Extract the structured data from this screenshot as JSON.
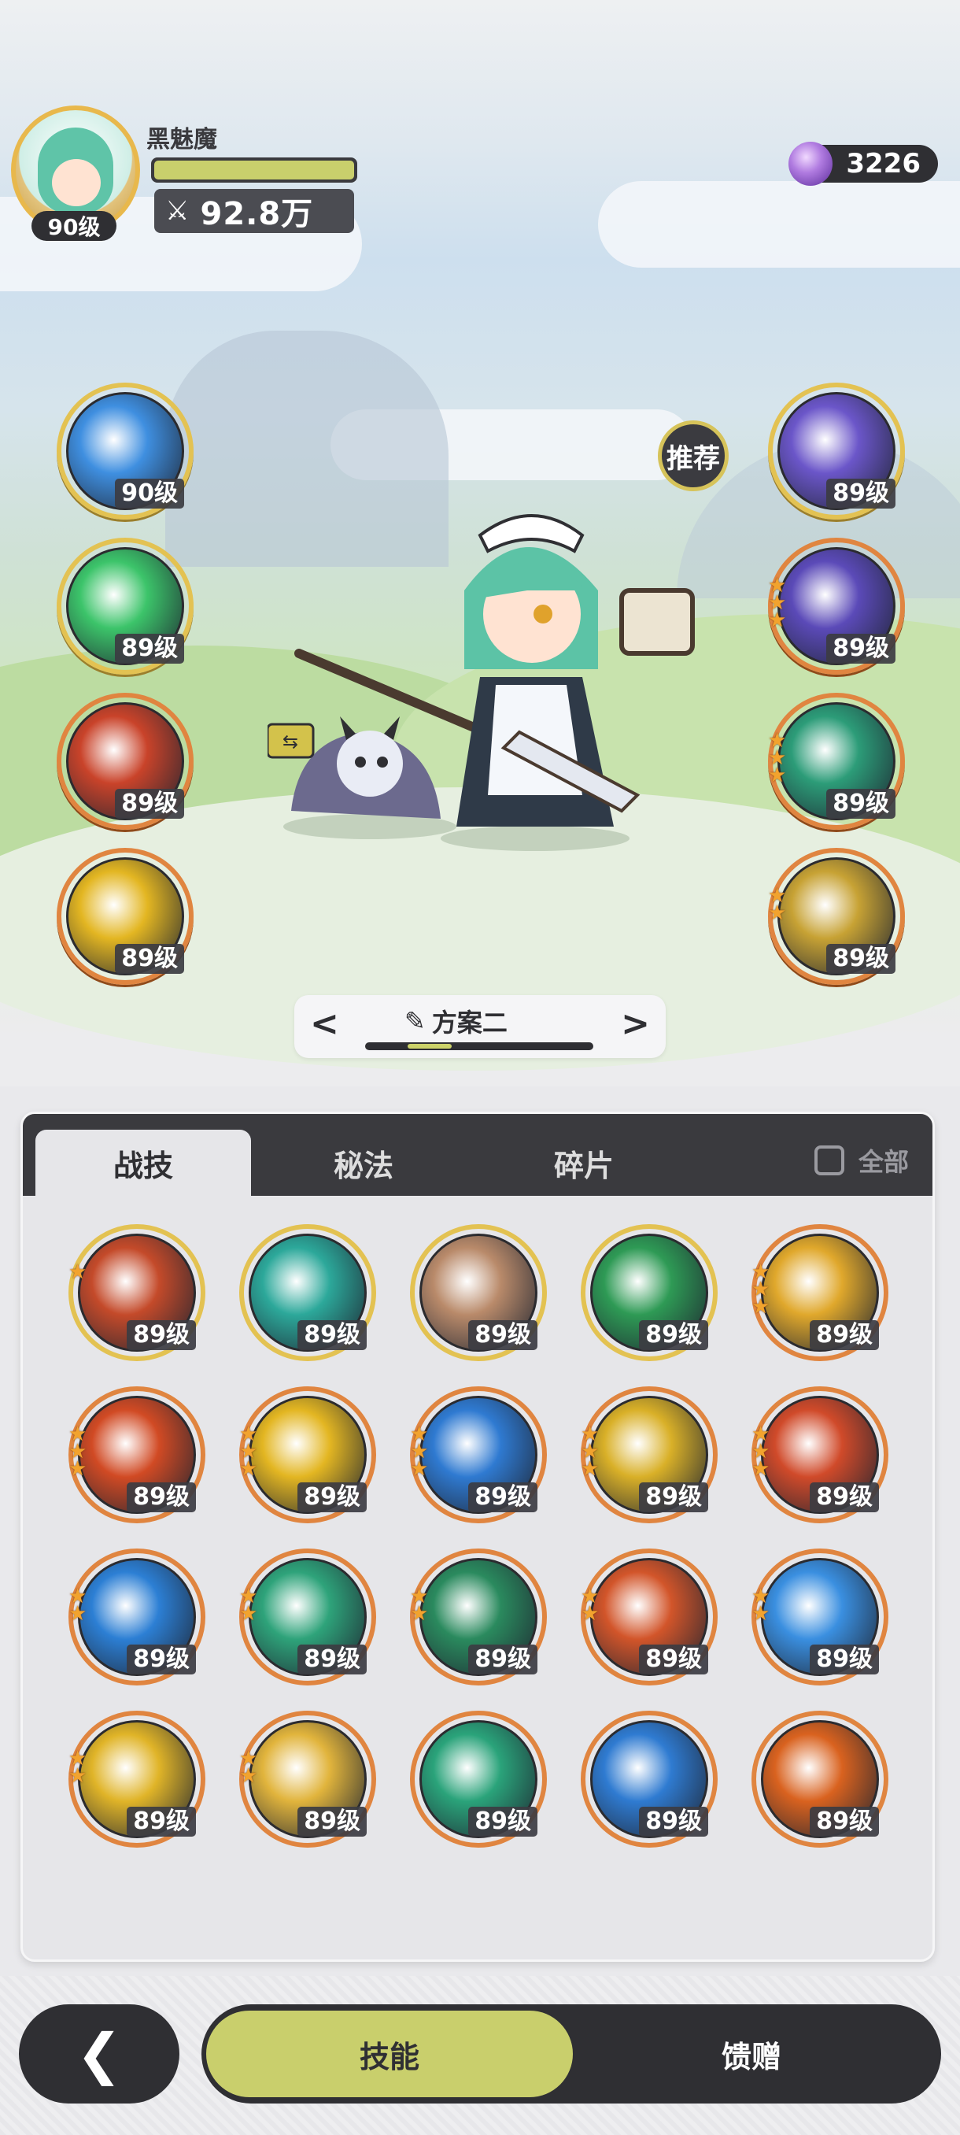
{
  "character": {
    "name": "黑魅魔",
    "level": "90级",
    "hp_fraction": 1.0,
    "power": "92.8万"
  },
  "currency": {
    "icon": "purple-gem-icon",
    "amount": "3226"
  },
  "recommend_label": "推荐",
  "left_skills": [
    {
      "level": "90级",
      "icon": "ice-burst-icon",
      "color": "#3f8fe0",
      "frame": "gold",
      "stars": 0
    },
    {
      "level": "89级",
      "icon": "green-wind-icon",
      "color": "#3cc46a",
      "frame": "gold",
      "stars": 0
    },
    {
      "level": "89级",
      "icon": "fire-meteor-icon",
      "color": "#c9432a",
      "frame": "orange",
      "stars": 0
    },
    {
      "level": "89级",
      "icon": "lightning-spark-icon",
      "color": "#e3b622",
      "frame": "orange",
      "stars": 0
    }
  ],
  "right_skills": [
    {
      "level": "89级",
      "icon": "arcane-galaxy-icon",
      "color": "#6b56c9",
      "frame": "gold",
      "stars": 0
    },
    {
      "level": "89级",
      "icon": "arcane-clock-icon",
      "color": "#5b4ab8",
      "frame": "orange",
      "stars": 3
    },
    {
      "level": "89级",
      "icon": "green-vortex-icon",
      "color": "#2c9c78",
      "frame": "orange",
      "stars": 3
    },
    {
      "level": "89级",
      "icon": "golden-shatter-icon",
      "color": "#c7a234",
      "frame": "orange",
      "stars": 2
    }
  ],
  "preset": {
    "prev": "<",
    "next": ">",
    "edit_icon": "pencil-icon",
    "name": "方案二"
  },
  "tabs": [
    {
      "label": "战技",
      "active": true
    },
    {
      "label": "秘法",
      "active": false
    },
    {
      "label": "碎片",
      "active": false
    }
  ],
  "all_filter": {
    "label": "全部",
    "checked": false
  },
  "grid_skills": [
    {
      "level": "89级",
      "icon": "fire-swirl-icon",
      "color": "#c44a2a",
      "frame": "gold",
      "stars": 1
    },
    {
      "level": "89级",
      "icon": "water-vortex-icon",
      "color": "#2ca89a",
      "frame": "gold",
      "stars": 0
    },
    {
      "level": "89级",
      "icon": "earth-cards-icon",
      "color": "#b98a6a",
      "frame": "gold",
      "stars": 0
    },
    {
      "level": "89级",
      "icon": "green-heal-cross-icon",
      "color": "#2e9a55",
      "frame": "gold",
      "stars": 0
    },
    {
      "level": "89级",
      "icon": "golden-burst-icon",
      "color": "#e0a82c",
      "frame": "orange",
      "stars": 3
    },
    {
      "level": "89级",
      "icon": "flame-blaze-icon",
      "color": "#d14a24",
      "frame": "orange",
      "stars": 3
    },
    {
      "level": "89级",
      "icon": "lightning-strike-icon",
      "color": "#e3b622",
      "frame": "orange",
      "stars": 3
    },
    {
      "level": "89级",
      "icon": "ice-shard-icon",
      "color": "#2f7ad1",
      "frame": "orange",
      "stars": 3
    },
    {
      "level": "89级",
      "icon": "golden-triangle-icon",
      "color": "#d9b028",
      "frame": "orange",
      "stars": 3
    },
    {
      "level": "89级",
      "icon": "fire-orb-icon",
      "color": "#d04a2a",
      "frame": "orange",
      "stars": 3
    },
    {
      "level": "89级",
      "icon": "blue-flame-icon",
      "color": "#2c7fd4",
      "frame": "orange",
      "stars": 2
    },
    {
      "level": "89级",
      "icon": "green-slash-icon",
      "color": "#2ea37a",
      "frame": "orange",
      "stars": 2
    },
    {
      "level": "89级",
      "icon": "thorn-vine-icon",
      "color": "#2a8a5e",
      "frame": "orange",
      "stars": 2
    },
    {
      "level": "89级",
      "icon": "lava-wave-icon",
      "color": "#d2552a",
      "frame": "orange",
      "stars": 2
    },
    {
      "level": "89级",
      "icon": "ice-crystal-icon",
      "color": "#3a8fe0",
      "frame": "orange",
      "stars": 2
    },
    {
      "level": "89级",
      "icon": "sun-orb-icon",
      "color": "#e0b428",
      "frame": "orange",
      "stars": 2
    },
    {
      "level": "89级",
      "icon": "star-sparkle-icon",
      "color": "#e1b43c",
      "frame": "orange",
      "stars": 2
    },
    {
      "level": "89级",
      "icon": "wind-sphere-icon",
      "color": "#2aa37a",
      "frame": "orange",
      "stars": 0
    },
    {
      "level": "89级",
      "icon": "blue-whirlpool-icon",
      "color": "#2f7bd1",
      "frame": "orange",
      "stars": 0
    },
    {
      "level": "89级",
      "icon": "fire-explosion-icon",
      "color": "#d9621f",
      "frame": "orange",
      "stars": 0
    }
  ],
  "bottom_nav": {
    "back_icon": "back-arrow-icon",
    "skills_label": "技能",
    "gift_label": "馈赠"
  }
}
